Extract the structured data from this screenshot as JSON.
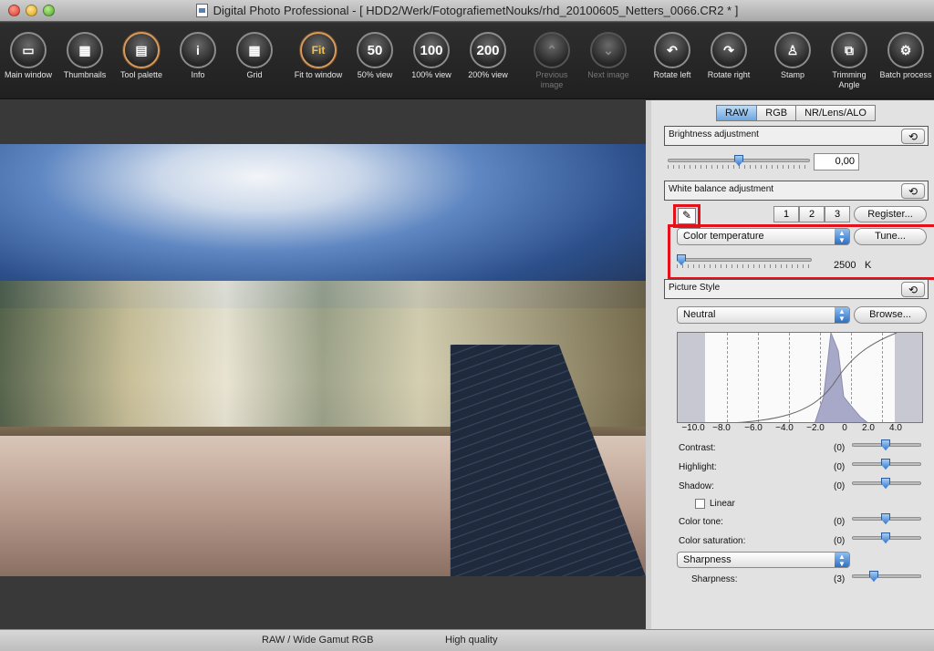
{
  "window": {
    "title": "Digital Photo Professional - [ HDD2/Werk/FotografiemetNouks/rhd_20100605_Netters_0066.CR2 * ]"
  },
  "toolbar": {
    "items": [
      {
        "label": "Main window",
        "icon": "folder-icon",
        "glyph": "▭"
      },
      {
        "label": "Thumbnails",
        "icon": "thumbnails-icon",
        "glyph": "▦"
      },
      {
        "label": "Tool palette",
        "icon": "tool-palette-icon",
        "glyph": "▤"
      },
      {
        "label": "Info",
        "icon": "info-icon",
        "glyph": "i"
      },
      {
        "label": "Grid",
        "icon": "grid-icon",
        "glyph": "▦"
      },
      {
        "label": "Fit to window",
        "icon": "fit-icon",
        "glyph": "Fit"
      },
      {
        "label": "50% view",
        "icon": "zoom-50-icon",
        "glyph": "50"
      },
      {
        "label": "100% view",
        "icon": "zoom-100-icon",
        "glyph": "100"
      },
      {
        "label": "200% view",
        "icon": "zoom-200-icon",
        "glyph": "200"
      },
      {
        "label": "Previous image",
        "icon": "previous-icon",
        "glyph": "⌃"
      },
      {
        "label": "Next image",
        "icon": "next-icon",
        "glyph": "⌄"
      },
      {
        "label": "Rotate left",
        "icon": "rotate-left-icon",
        "glyph": "↶"
      },
      {
        "label": "Rotate right",
        "icon": "rotate-right-icon",
        "glyph": "↷"
      },
      {
        "label": "Stamp",
        "icon": "stamp-icon",
        "glyph": "♙"
      },
      {
        "label": "Trimming Angle",
        "icon": "trimming-icon",
        "glyph": "⧉"
      },
      {
        "label": "Batch process",
        "icon": "batch-icon",
        "glyph": "⚙"
      }
    ]
  },
  "palette": {
    "tabs": [
      "RAW",
      "RGB",
      "NR/Lens/ALO"
    ],
    "brightness": {
      "heading": "Brightness adjustment",
      "value": "0,00",
      "level": 0.5
    },
    "white_balance": {
      "heading": "White balance adjustment",
      "presets": [
        "1",
        "2",
        "3"
      ],
      "register_label": "Register...",
      "mode": "Color temperature",
      "tune_label": "Tune...",
      "temperature": "2500",
      "unit": "K"
    },
    "picture_style": {
      "heading": "Picture Style",
      "style": "Neutral",
      "browse_label": "Browse...",
      "axis_ticks": [
        "−10.0",
        "−8.0",
        "−6.0",
        "−4.0",
        "−2.0",
        "0",
        "2.0",
        "4.0"
      ],
      "params": [
        {
          "label": "Contrast:",
          "value": "(0)"
        },
        {
          "label": "Highlight:",
          "value": "(0)"
        },
        {
          "label": "Shadow:",
          "value": "(0)"
        }
      ],
      "linear_label": "Linear",
      "color_params": [
        {
          "label": "Color tone:",
          "value": "(0)"
        },
        {
          "label": "Color saturation:",
          "value": "(0)"
        }
      ],
      "sharpness_mode": "Sharpness",
      "sharpness": {
        "label": "Sharpness:",
        "value": "(3)"
      }
    }
  },
  "status": {
    "color_space": "RAW / Wide Gamut RGB",
    "quality": "High quality"
  }
}
